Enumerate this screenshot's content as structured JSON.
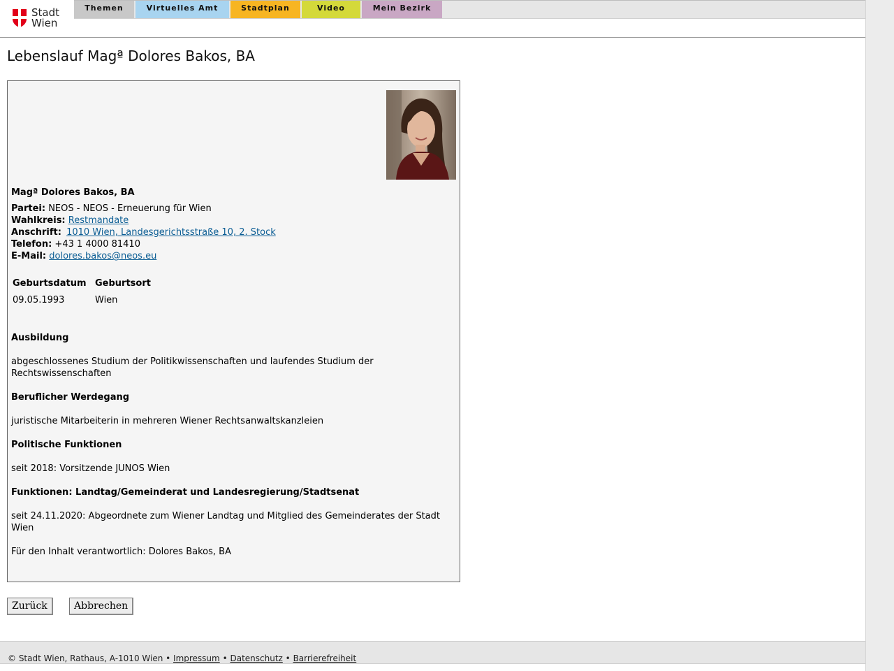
{
  "header": {
    "logo_line1": "Stadt",
    "logo_line2": "Wien",
    "brand_color": "#e2001a",
    "nav": [
      {
        "label": "Themen",
        "color": "#c8c8c8"
      },
      {
        "label": "Virtuelles Amt",
        "color": "#a8d4f0"
      },
      {
        "label": "Stadtplan",
        "color": "#f7b522"
      },
      {
        "label": "Video",
        "color": "#d4d93a"
      },
      {
        "label": "Mein Bezirk",
        "color": "#c9a7c4"
      }
    ]
  },
  "page": {
    "title": "Lebenslauf Magª Dolores Bakos, BA"
  },
  "profile": {
    "name": "Magª Dolores Bakos, BA",
    "partei_label": "Partei:",
    "partei_value": "NEOS - NEOS - Erneuerung für Wien",
    "wahlkreis_label": "Wahlkreis:",
    "wahlkreis_value": "Restmandate",
    "anschrift_label": "Anschrift:",
    "anschrift_value": "1010 Wien, Landesgerichtsstraße 10, 2. Stock",
    "telefon_label": "Telefon:",
    "telefon_value": "+43 1 4000 81410",
    "email_label": "E-Mail:",
    "email_value": "dolores.bakos@neos.eu"
  },
  "birth": {
    "date_header": "Geburtsdatum",
    "place_header": "Geburtsort",
    "date_value": "09.05.1993",
    "place_value": "Wien"
  },
  "sections": [
    {
      "heading": "Ausbildung",
      "text": "abgeschlossenes Studium der Politikwissenschaften und laufendes Studium der Rechtswissenschaften"
    },
    {
      "heading": "Beruflicher Werdegang",
      "text": "juristische Mitarbeiterin in mehreren Wiener Rechtsanwaltskanzleien"
    },
    {
      "heading": "Politische Funktionen",
      "text": "seit 2018: Vorsitzende JUNOS Wien"
    },
    {
      "heading": "Funktionen: Landtag/Gemeinderat und Landesregierung/Stadtsenat",
      "text": "seit 24.11.2020: Abgeordnete zum Wiener Landtag und Mitglied des Gemeinderates der Stadt Wien"
    }
  ],
  "responsible": "Für den Inhalt verantwortlich: Dolores Bakos, BA",
  "buttons": {
    "back": "Zurück",
    "cancel": "Abbrechen"
  },
  "footer": {
    "copyright": "© Stadt Wien, Rathaus, A-1010 Wien •",
    "sep": "•",
    "impressum": "Impressum",
    "datenschutz": "Datenschutz",
    "barrierefreiheit": "Barrierefreiheit"
  }
}
